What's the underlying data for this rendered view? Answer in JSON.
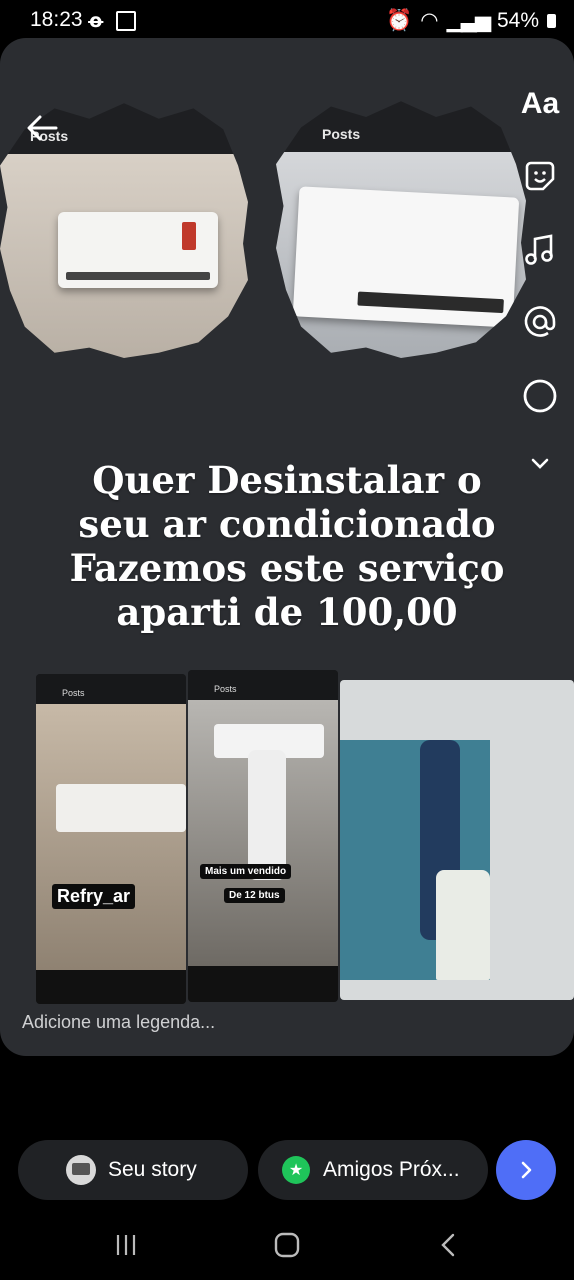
{
  "status_bar": {
    "time": "18:23",
    "battery": "54%"
  },
  "editor": {
    "photos_top": [
      {
        "label": "Posts"
      },
      {
        "label": "Posts"
      }
    ],
    "headline": [
      "Quer Desinstalar  o",
      "seu ar condicionado",
      "Fazemos este serviço",
      "aparti de 100,00"
    ],
    "tools": {
      "text_label": "Aa"
    },
    "collage": {
      "shot1": {
        "title": "Posts",
        "tag": "Refry_ar"
      },
      "shot2": {
        "title": "Posts",
        "tag1": "Mais um vendido",
        "tag2": "De 12 btus"
      }
    },
    "caption_placeholder": "Adicione uma legenda..."
  },
  "share": {
    "your_story": "Seu story",
    "close_friends": "Amigos Próx..."
  },
  "colors": {
    "accent": "#4f6ef7",
    "close_friends_green": "#1fc45a",
    "card_bg": "#2b2d31"
  }
}
